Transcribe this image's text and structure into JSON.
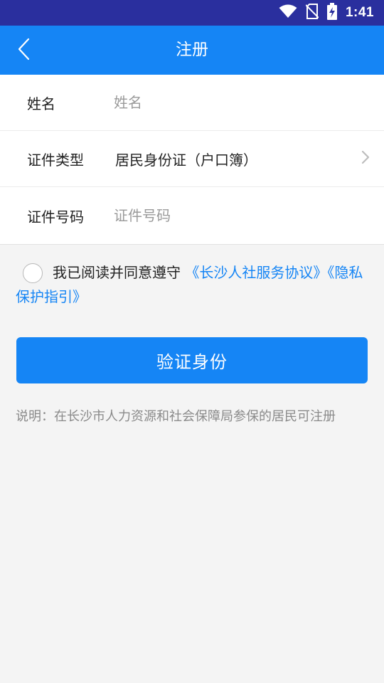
{
  "status_bar": {
    "time": "1:41",
    "icons": [
      "wifi-icon",
      "no-sim-icon",
      "battery-charging-icon"
    ]
  },
  "header": {
    "title": "注册",
    "back_icon": "chevron-left-icon"
  },
  "form": {
    "name": {
      "label": "姓名",
      "placeholder": "姓名",
      "value": ""
    },
    "id_type": {
      "label": "证件类型",
      "value": "居民身份证（户口簿）",
      "icon": "chevron-right-icon"
    },
    "id_number": {
      "label": "证件号码",
      "placeholder": "证件号码",
      "value": ""
    }
  },
  "agreement": {
    "checked": false,
    "text": "我已阅读并同意遵守",
    "link1": "《长沙人社服务协议》",
    "link2": "《隐私保护指引》"
  },
  "verify_button": {
    "label": "验证身份"
  },
  "note": {
    "text": "说明：在长沙市人力资源和社会保障局参保的居民可注册"
  },
  "colors": {
    "status_bar": "#2a2f9e",
    "primary": "#1585f5",
    "background": "#f4f4f4",
    "text": "#222222",
    "placeholder": "#9a9a9a",
    "note": "#8a8a8a"
  }
}
